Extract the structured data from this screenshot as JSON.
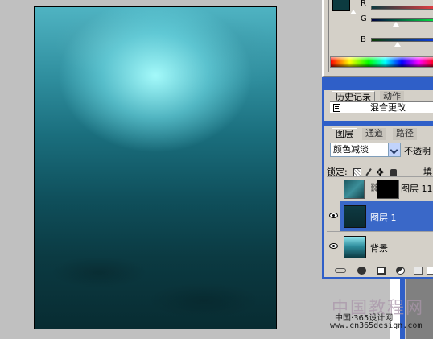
{
  "color_panel": {
    "channels": [
      "R",
      "G",
      "B"
    ],
    "foreground_color": "#0c3b40",
    "background_color": "#000000"
  },
  "history_panel": {
    "tabs": [
      "历史记录",
      "动作"
    ],
    "items": [
      "混合更改"
    ]
  },
  "layers_panel": {
    "tabs": [
      "图层",
      "通道",
      "路径"
    ],
    "blend_mode": "颜色减淡",
    "opacity_label": "不透明",
    "lock_label": "锁定:",
    "fill_label": "填",
    "layers": [
      {
        "name": "图层 11",
        "visible": false,
        "selected": false,
        "has_mask": true
      },
      {
        "name": "图层 1",
        "visible": true,
        "selected": true,
        "has_mask": false
      },
      {
        "name": "背景",
        "visible": true,
        "selected": false,
        "has_mask": false
      }
    ]
  },
  "watermark": {
    "brand": "中国教程网",
    "subtitle": "中国·365设计网",
    "url": "www.cn365design.com"
  }
}
